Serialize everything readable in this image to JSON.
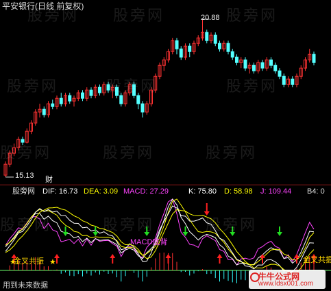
{
  "upper": {
    "title": "平安银行(日线 前复权)",
    "high_label": "20.88",
    "low_label": "15.13",
    "finance_marker": "财"
  },
  "lower": {
    "indicator_name": "股旁网",
    "dif_label": "DIF: 16.73",
    "dea_label": "DEA: 3.09",
    "macd_label": "MACD: 27.29",
    "k_label": "K: 75.80",
    "d_label": "D: 58.98",
    "j_label": "J: 109.44",
    "b4_label": "B4: 0",
    "annotation_left": "金叉共振",
    "annotation_right": "金叉共振",
    "annotation_mid": "MACD底背",
    "bottom_text": "用到未来数据"
  },
  "watermark": "股旁网",
  "stamp": {
    "line1": "牛牛公式网",
    "line2": "www.ldsx001.com"
  },
  "colors": {
    "up_candle": "#ff3232",
    "down_candle": "#54ffff",
    "dif": "#ffffff",
    "dea": "#ffff00",
    "macd": "#ff44ff",
    "k": "#ffffff",
    "d": "#ffff00",
    "j": "#ff44ff",
    "up_arrow": "#ff2020",
    "down_arrow": "#22dd22"
  },
  "candles": [
    {
      "o": 15.2,
      "c": 15.6,
      "h": 15.7,
      "l": 15.13
    },
    {
      "o": 15.6,
      "c": 16.0,
      "h": 16.1,
      "l": 15.5
    },
    {
      "o": 16.0,
      "c": 16.2,
      "h": 16.35,
      "l": 15.9
    },
    {
      "o": 16.2,
      "c": 16.5,
      "h": 16.6,
      "l": 16.1
    },
    {
      "o": 16.5,
      "c": 16.4,
      "h": 16.6,
      "l": 16.3
    },
    {
      "o": 16.4,
      "c": 16.8,
      "h": 16.9,
      "l": 16.35
    },
    {
      "o": 16.8,
      "c": 17.1,
      "h": 17.2,
      "l": 16.7
    },
    {
      "o": 17.1,
      "c": 17.5,
      "h": 17.6,
      "l": 17.0
    },
    {
      "o": 17.5,
      "c": 17.6,
      "h": 17.8,
      "l": 17.3
    },
    {
      "o": 17.6,
      "c": 17.4,
      "h": 17.7,
      "l": 17.3
    },
    {
      "o": 17.4,
      "c": 17.8,
      "h": 17.9,
      "l": 17.3
    },
    {
      "o": 17.8,
      "c": 17.7,
      "h": 17.95,
      "l": 17.6
    },
    {
      "o": 17.7,
      "c": 18.0,
      "h": 18.1,
      "l": 17.6
    },
    {
      "o": 18.0,
      "c": 17.8,
      "h": 18.2,
      "l": 17.7
    },
    {
      "o": 17.8,
      "c": 18.1,
      "h": 18.2,
      "l": 17.7
    },
    {
      "o": 18.1,
      "c": 17.9,
      "h": 18.2,
      "l": 17.8
    },
    {
      "o": 17.9,
      "c": 18.0,
      "h": 18.1,
      "l": 17.7
    },
    {
      "o": 18.0,
      "c": 18.2,
      "h": 18.3,
      "l": 17.9
    },
    {
      "o": 18.2,
      "c": 18.0,
      "h": 18.3,
      "l": 17.9
    },
    {
      "o": 18.0,
      "c": 18.3,
      "h": 18.4,
      "l": 17.9
    },
    {
      "o": 18.3,
      "c": 18.1,
      "h": 18.4,
      "l": 18.0
    },
    {
      "o": 18.1,
      "c": 18.4,
      "h": 18.5,
      "l": 18.0
    },
    {
      "o": 18.4,
      "c": 18.2,
      "h": 18.5,
      "l": 18.1
    },
    {
      "o": 18.2,
      "c": 18.5,
      "h": 18.6,
      "l": 18.1
    },
    {
      "o": 18.5,
      "c": 18.3,
      "h": 18.6,
      "l": 18.2
    },
    {
      "o": 18.3,
      "c": 18.4,
      "h": 18.5,
      "l": 18.0
    },
    {
      "o": 18.4,
      "c": 18.1,
      "h": 18.5,
      "l": 18.0
    },
    {
      "o": 18.1,
      "c": 17.8,
      "h": 18.2,
      "l": 17.7
    },
    {
      "o": 17.8,
      "c": 18.2,
      "h": 18.3,
      "l": 17.7
    },
    {
      "o": 18.2,
      "c": 18.5,
      "h": 18.6,
      "l": 18.1
    },
    {
      "o": 18.5,
      "c": 18.1,
      "h": 18.6,
      "l": 18.0
    },
    {
      "o": 18.1,
      "c": 17.8,
      "h": 18.2,
      "l": 17.6
    },
    {
      "o": 17.8,
      "c": 17.5,
      "h": 17.9,
      "l": 17.3
    },
    {
      "o": 17.5,
      "c": 17.8,
      "h": 17.9,
      "l": 17.4
    },
    {
      "o": 17.8,
      "c": 18.3,
      "h": 18.4,
      "l": 17.7
    },
    {
      "o": 18.3,
      "c": 18.8,
      "h": 18.9,
      "l": 18.2
    },
    {
      "o": 18.8,
      "c": 19.2,
      "h": 19.3,
      "l": 18.7
    },
    {
      "o": 19.2,
      "c": 19.4,
      "h": 19.5,
      "l": 19.0
    },
    {
      "o": 19.4,
      "c": 19.7,
      "h": 19.8,
      "l": 19.3
    },
    {
      "o": 19.7,
      "c": 20.1,
      "h": 20.2,
      "l": 19.6
    },
    {
      "o": 20.1,
      "c": 19.8,
      "h": 20.2,
      "l": 19.6
    },
    {
      "o": 19.8,
      "c": 19.5,
      "h": 19.9,
      "l": 19.4
    },
    {
      "o": 19.5,
      "c": 19.9,
      "h": 20.0,
      "l": 19.4
    },
    {
      "o": 19.9,
      "c": 19.7,
      "h": 20.0,
      "l": 19.5
    },
    {
      "o": 19.7,
      "c": 20.0,
      "h": 20.1,
      "l": 19.6
    },
    {
      "o": 20.0,
      "c": 20.2,
      "h": 20.3,
      "l": 19.9
    },
    {
      "o": 20.2,
      "c": 20.4,
      "h": 20.88,
      "l": 20.1
    },
    {
      "o": 20.4,
      "c": 20.1,
      "h": 20.5,
      "l": 20.0
    },
    {
      "o": 20.1,
      "c": 20.3,
      "h": 20.4,
      "l": 20.0
    },
    {
      "o": 20.3,
      "c": 20.0,
      "h": 20.4,
      "l": 19.9
    },
    {
      "o": 20.0,
      "c": 19.8,
      "h": 20.1,
      "l": 19.7
    },
    {
      "o": 19.8,
      "c": 20.0,
      "h": 20.1,
      "l": 19.7
    },
    {
      "o": 20.0,
      "c": 19.7,
      "h": 20.1,
      "l": 19.6
    },
    {
      "o": 19.7,
      "c": 19.5,
      "h": 19.8,
      "l": 19.4
    },
    {
      "o": 19.5,
      "c": 19.3,
      "h": 19.6,
      "l": 19.2
    },
    {
      "o": 19.3,
      "c": 19.4,
      "h": 19.5,
      "l": 19.1
    },
    {
      "o": 19.4,
      "c": 19.1,
      "h": 19.5,
      "l": 19.0
    },
    {
      "o": 19.1,
      "c": 19.2,
      "h": 19.3,
      "l": 18.9
    },
    {
      "o": 19.2,
      "c": 19.0,
      "h": 19.3,
      "l": 18.9
    },
    {
      "o": 19.0,
      "c": 19.3,
      "h": 19.4,
      "l": 18.9
    },
    {
      "o": 19.3,
      "c": 19.1,
      "h": 19.4,
      "l": 19.0
    },
    {
      "o": 19.1,
      "c": 19.4,
      "h": 19.5,
      "l": 19.0
    },
    {
      "o": 19.4,
      "c": 19.2,
      "h": 19.5,
      "l": 19.1
    },
    {
      "o": 19.2,
      "c": 19.0,
      "h": 19.3,
      "l": 18.9
    },
    {
      "o": 19.0,
      "c": 18.8,
      "h": 19.1,
      "l": 18.7
    },
    {
      "o": 18.8,
      "c": 18.5,
      "h": 18.9,
      "l": 18.4
    },
    {
      "o": 18.5,
      "c": 18.7,
      "h": 18.8,
      "l": 18.4
    },
    {
      "o": 18.7,
      "c": 18.5,
      "h": 18.8,
      "l": 18.4
    },
    {
      "o": 18.5,
      "c": 18.8,
      "h": 18.9,
      "l": 18.4
    },
    {
      "o": 18.8,
      "c": 19.1,
      "h": 19.2,
      "l": 18.7
    },
    {
      "o": 19.1,
      "c": 19.4,
      "h": 19.5,
      "l": 19.0
    },
    {
      "o": 19.4,
      "c": 19.6,
      "h": 19.8,
      "l": 19.3
    },
    {
      "o": 19.6,
      "c": 19.3,
      "h": 19.7,
      "l": 19.2
    }
  ]
}
